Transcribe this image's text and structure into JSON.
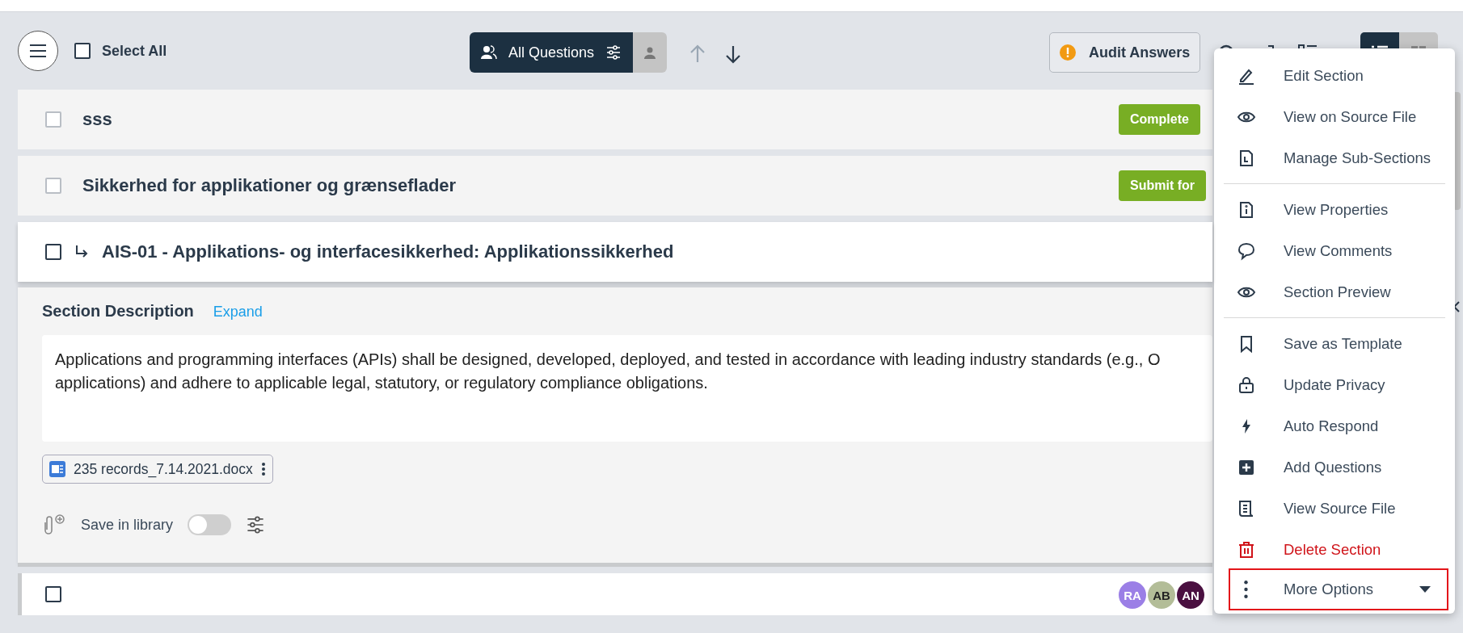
{
  "toolbar": {
    "select_all": {
      "label": "Select All",
      "checked": false
    },
    "filter": {
      "label": "All Questions"
    },
    "audit_button": {
      "label": "Audit Answers"
    },
    "view_toggle": [
      {
        "kind": "list",
        "selected": true
      },
      {
        "kind": "grid",
        "selected": false
      }
    ]
  },
  "sections": [
    {
      "title": "sss",
      "checked": false,
      "selected": false,
      "kind": "group",
      "action": "Complete"
    },
    {
      "title": "Sikkerhed for applikationer og grænseflader",
      "checked": false,
      "selected": false,
      "kind": "group",
      "action": "Submit for"
    },
    {
      "title": "AIS-01 - Applikations- og interfacesikkerhed: Applikationssikkerhed",
      "checked": false,
      "selected": true,
      "kind": "sub"
    }
  ],
  "description": {
    "heading": "Section Description",
    "expand": "Expand",
    "lines": [
      "Applications and programming interfaces (APIs) shall be designed, developed, deployed, and tested in accordance with leading industry standards (e.g., O",
      "applications) and adhere to applicable legal, statutory, or regulatory compliance obligations."
    ],
    "attachment": "235 records_7.14.2021.docx",
    "save_in_library": {
      "label": "Save in library",
      "on": false
    }
  },
  "question_row": {
    "checked": false,
    "assignees": [
      {
        "initials": "RA",
        "color": "#9b7fe6"
      },
      {
        "initials": "AB",
        "color": "#b3bd98"
      },
      {
        "initials": "AN",
        "color": "#4a1040"
      }
    ]
  },
  "menu": {
    "groups": [
      [
        {
          "label": "Edit Section",
          "highlighted": false
        },
        {
          "label": "View on Source File",
          "highlighted": false
        },
        {
          "label": "Manage Sub-Sections",
          "highlighted": false
        }
      ],
      [
        {
          "label": "View Properties",
          "highlighted": false
        },
        {
          "label": "View Comments",
          "highlighted": false
        },
        {
          "label": "Section Preview",
          "highlighted": false
        }
      ],
      [
        {
          "label": "Save as Template",
          "highlighted": false
        },
        {
          "label": "Update Privacy",
          "highlighted": false
        },
        {
          "label": "Auto Respond",
          "highlighted": false
        },
        {
          "label": "Add Questions",
          "highlighted": false
        },
        {
          "label": "View Source File",
          "highlighted": false
        },
        {
          "label": "Delete Section",
          "kind": "danger",
          "highlighted": false
        },
        {
          "label": "More Options",
          "kind": "expand",
          "highlighted": true
        }
      ]
    ]
  }
}
